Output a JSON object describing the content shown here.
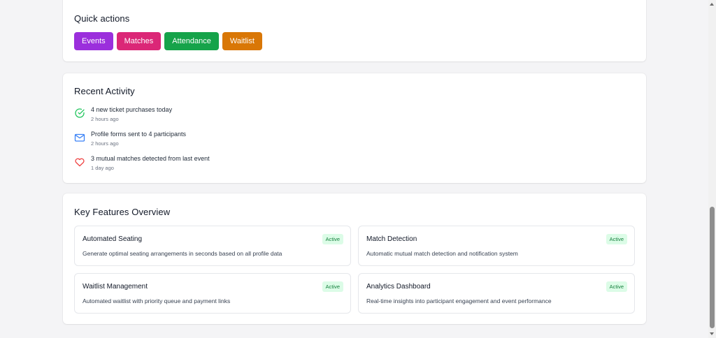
{
  "quick_actions": {
    "title": "Quick actions",
    "buttons": [
      {
        "label": "Events",
        "color": "#9b2fdc"
      },
      {
        "label": "Matches",
        "color": "#db2777"
      },
      {
        "label": "Attendance",
        "color": "#16a34a"
      },
      {
        "label": "Waitlist",
        "color": "#d97706"
      }
    ]
  },
  "recent_activity": {
    "title": "Recent Activity",
    "items": [
      {
        "icon": "check-circle-icon",
        "icon_color": "#22c55e",
        "text": "4 new ticket purchases today",
        "time": "2 hours ago"
      },
      {
        "icon": "mail-icon",
        "icon_color": "#3b82f6",
        "text": "Profile forms sent to 4 participants",
        "time": "2 hours ago"
      },
      {
        "icon": "heart-icon",
        "icon_color": "#ef4444",
        "text": "3 mutual matches detected from last event",
        "time": "1 day ago"
      }
    ]
  },
  "key_features": {
    "title": "Key Features Overview",
    "features": [
      {
        "title": "Automated Seating",
        "status": "Active",
        "description": "Generate optimal seating arrangements in seconds based on all profile data"
      },
      {
        "title": "Match Detection",
        "status": "Active",
        "description": "Automatic mutual match detection and notification system"
      },
      {
        "title": "Waitlist Management",
        "status": "Active",
        "description": "Automated waitlist with priority queue and payment links"
      },
      {
        "title": "Analytics Dashboard",
        "status": "Active",
        "description": "Real-time insights into participant engagement and event performance"
      }
    ]
  }
}
